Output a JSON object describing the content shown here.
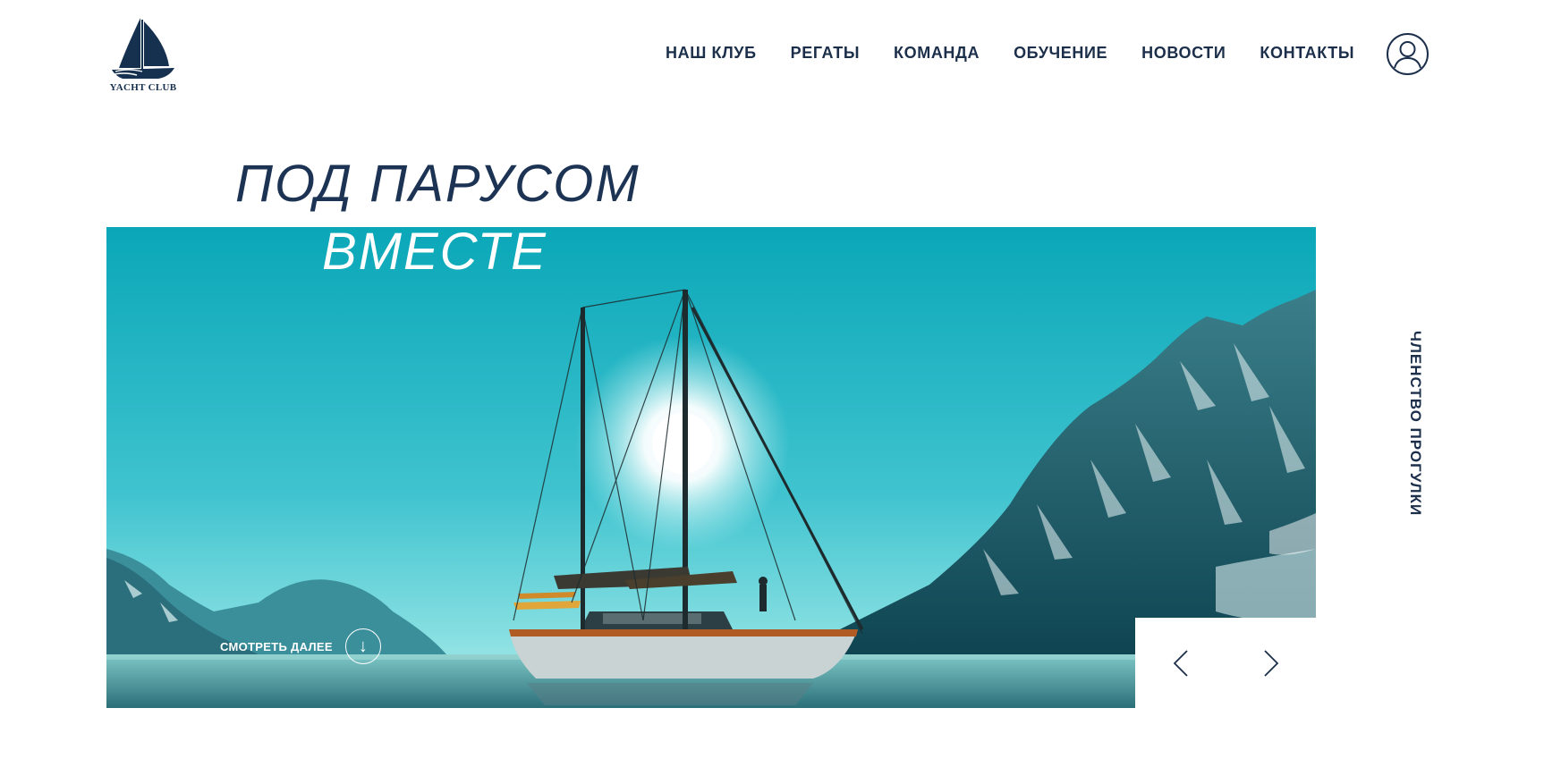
{
  "logo": {
    "text": "YACHT CLUB",
    "icon": "sailboat-logo"
  },
  "nav": {
    "items": [
      {
        "label": "НАШ КЛУБ"
      },
      {
        "label": "РЕГАТЫ"
      },
      {
        "label": "КОМАНДА"
      },
      {
        "label": "ОБУЧЕНИЕ"
      },
      {
        "label": "НОВОСТИ"
      },
      {
        "label": "КОНТАКТЫ"
      }
    ],
    "user_icon": "user-icon"
  },
  "hero": {
    "title_line1": "ПОД ПАРУСОМ",
    "title_line2": "ВМЕСТЕ",
    "see_more_label": "СМОТРЕТЬ ДАЛЕЕ",
    "see_more_icon": "arrow-down-icon",
    "image": "sailboat-fjord-photo",
    "prev_icon": "chevron-left-icon",
    "next_icon": "chevron-right-icon"
  },
  "side": {
    "vertical_label": "ЧЛЕНСТВО ПРОГУЛКИ"
  },
  "colors": {
    "brand_navy": "#1b2e4a",
    "sky": "#23b3c4",
    "white": "#ffffff"
  }
}
